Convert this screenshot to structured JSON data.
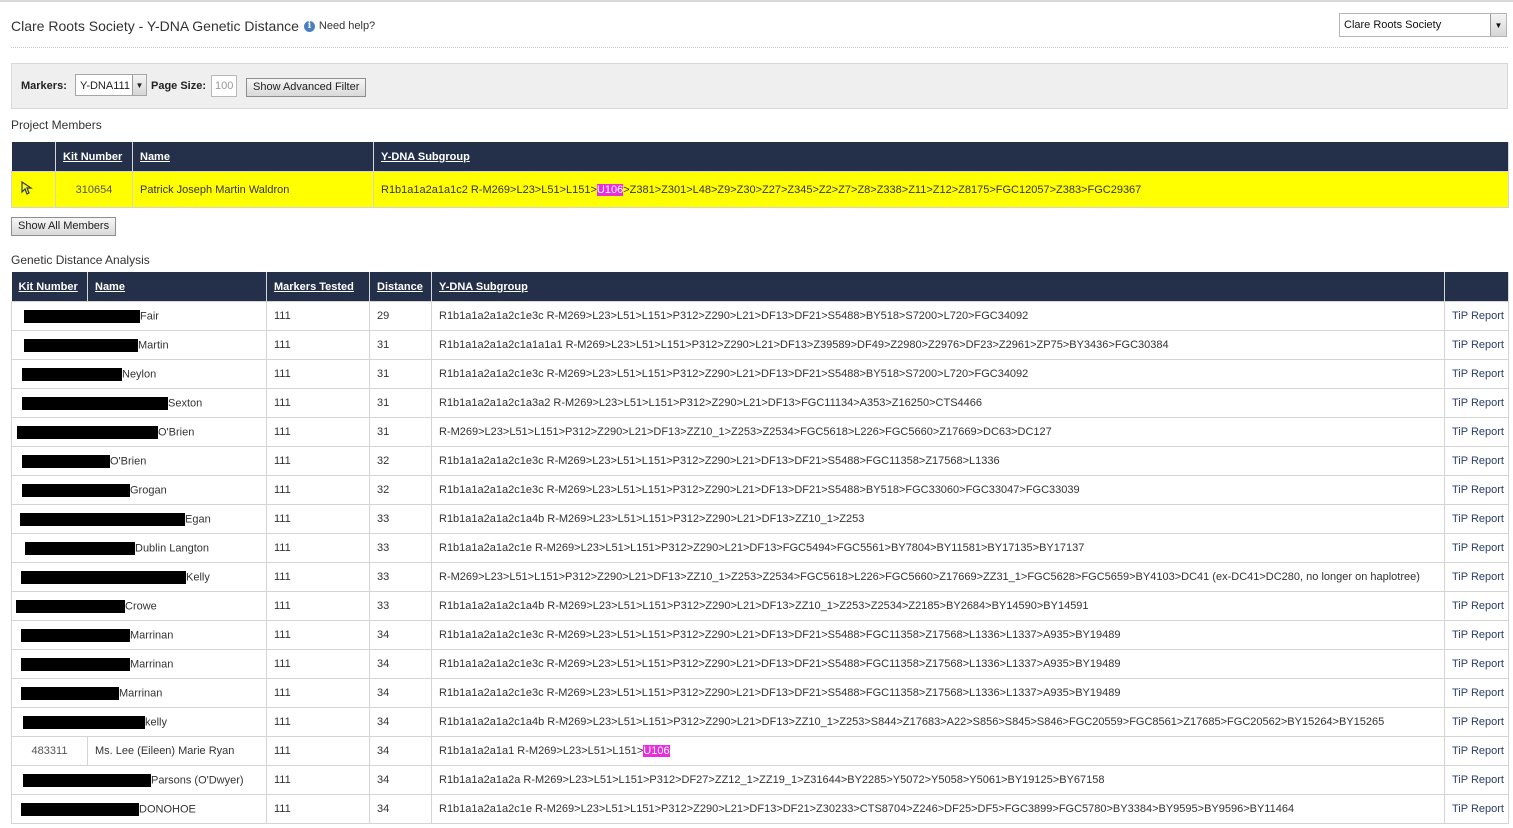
{
  "header": {
    "title": "Clare Roots Society - Y-DNA Genetic Distance",
    "help_text": "Need help?",
    "help_icon": "info-icon",
    "project_select": "Clare Roots Society"
  },
  "filter": {
    "markers_label": "Markers:",
    "markers_value": "Y-DNA111",
    "page_size_label": "Page Size:",
    "page_size_value": "100",
    "advanced_filter_button": "Show Advanced Filter"
  },
  "members": {
    "section_title": "Project Members",
    "columns": [
      "",
      "Kit Number",
      "Name",
      "Y-DNA Subgroup"
    ],
    "selected": {
      "kit": "310654",
      "name": "Patrick Joseph Martin Waldron",
      "subgroup_pre": "R1b1a1a2a1a1c2 R-M269>L23>L51>L151>",
      "subgroup_hl": "U106",
      "subgroup_post": ">Z381>Z301>L48>Z9>Z30>Z27>Z345>Z2>Z7>Z8>Z338>Z11>Z12>Z8175>FGC12057>Z383>FGC29367"
    },
    "show_all_button": "Show All Members"
  },
  "analysis": {
    "section_title": "Genetic Distance Analysis",
    "columns": [
      "Kit Number",
      "Name",
      "Markers Tested",
      "Distance",
      "Y-DNA Subgroup",
      ""
    ],
    "rows": [
      {
        "kit": "",
        "redact": 116,
        "pad": 12,
        "name": "Fair",
        "markers": "111",
        "distance": "29",
        "subgroup": "R1b1a1a2a1a2c1e3c R-M269>L23>L51>L151>P312>Z290>L21>DF13>DF21>S5488>BY518>S7200>L720>FGC34092",
        "tip": "TiP Report"
      },
      {
        "kit": "",
        "redact": 114,
        "pad": 12,
        "name": "Martin",
        "markers": "111",
        "distance": "31",
        "subgroup": "R1b1a1a2a1a2c1a1a1a1 R-M269>L23>L51>L151>P312>Z290>L21>DF13>Z39589>DF49>Z2980>Z2976>DF23>Z2961>ZP75>BY3436>FGC30384",
        "tip": "TiP Report"
      },
      {
        "kit": "",
        "redact": 100,
        "pad": 10,
        "name": "Neylon",
        "markers": "111",
        "distance": "31",
        "subgroup": "R1b1a1a2a1a2c1e3c R-M269>L23>L51>L151>P312>Z290>L21>DF13>DF21>S5488>BY518>S7200>L720>FGC34092",
        "tip": "TiP Report"
      },
      {
        "kit": "",
        "redact": 146,
        "pad": 10,
        "name": "Sexton",
        "markers": "111",
        "distance": "31",
        "subgroup": "R1b1a1a2a1a2c1a3a2 R-M269>L23>L51>L151>P312>Z290>L21>DF13>FGC11134>A353>Z16250>CTS4466",
        "tip": "TiP Report"
      },
      {
        "kit": "",
        "redact": 141,
        "pad": 5,
        "name": "O'Brien",
        "markers": "111",
        "distance": "31",
        "subgroup": "R-M269>L23>L51>L151>P312>Z290>L21>DF13>ZZ10_1>Z253>Z2534>FGC5618>L226>FGC5660>Z17669>DC63>DC127",
        "tip": "TiP Report"
      },
      {
        "kit": "",
        "redact": 88,
        "pad": 10,
        "name": "O'Brien",
        "markers": "111",
        "distance": "32",
        "subgroup": "R1b1a1a2a1a2c1e3c R-M269>L23>L51>L151>P312>Z290>L21>DF13>DF21>S5488>FGC11358>Z17568>L1336",
        "tip": "TiP Report"
      },
      {
        "kit": "",
        "redact": 108,
        "pad": 10,
        "name": "Grogan",
        "markers": "111",
        "distance": "32",
        "subgroup": "R1b1a1a2a1a2c1e3c R-M269>L23>L51>L151>P312>Z290>L21>DF13>DF21>S5488>BY518>FGC33060>FGC33047>FGC33039",
        "tip": "TiP Report"
      },
      {
        "kit": "",
        "redact": 165,
        "pad": 8,
        "name": "Egan",
        "markers": "111",
        "distance": "33",
        "subgroup": "R1b1a1a2a1a2c1a4b R-M269>L23>L51>L151>P312>Z290>L21>DF13>ZZ10_1>Z253",
        "tip": "TiP Report"
      },
      {
        "kit": "",
        "redact": 110,
        "pad": 13,
        "name": "Dublin Langton",
        "markers": "111",
        "distance": "33",
        "subgroup": "R1b1a1a2a1a2c1e R-M269>L23>L51>L151>P312>Z290>L21>DF13>FGC5494>FGC5561>BY7804>BY11581>BY17135>BY17137",
        "tip": "TiP Report"
      },
      {
        "kit": "",
        "redact": 165,
        "pad": 9,
        "name": "Kelly",
        "markers": "111",
        "distance": "33",
        "subgroup": "R-M269>L23>L51>L151>P312>Z290>L21>DF13>ZZ10_1>Z253>Z2534>FGC5618>L226>FGC5660>Z17669>ZZ31_1>FGC5628>FGC5659>BY4103>DC41 (ex-DC41>DC280, no longer on haplotree)",
        "tip": "TiP Report"
      },
      {
        "kit": "",
        "redact": 109,
        "pad": 4,
        "name": "Crowe",
        "markers": "111",
        "distance": "33",
        "subgroup": "R1b1a1a2a1a2c1a4b R-M269>L23>L51>L151>P312>Z290>L21>DF13>ZZ10_1>Z253>Z2534>Z2185>BY2684>BY14590>BY14591",
        "tip": "TiP Report"
      },
      {
        "kit": "",
        "redact": 109,
        "pad": 9,
        "name": "Marrinan",
        "markers": "111",
        "distance": "34",
        "subgroup": "R1b1a1a2a1a2c1e3c R-M269>L23>L51>L151>P312>Z290>L21>DF13>DF21>S5488>FGC11358>Z17568>L1336>L1337>A935>BY19489",
        "tip": "TiP Report"
      },
      {
        "kit": "",
        "redact": 109,
        "pad": 9,
        "name": "Marrinan",
        "markers": "111",
        "distance": "34",
        "subgroup": "R1b1a1a2a1a2c1e3c R-M269>L23>L51>L151>P312>Z290>L21>DF13>DF21>S5488>FGC11358>Z17568>L1336>L1337>A935>BY19489",
        "tip": "TiP Report"
      },
      {
        "kit": "",
        "redact": 98,
        "pad": 9,
        "name": "Marrinan",
        "markers": "111",
        "distance": "34",
        "subgroup": "R1b1a1a2a1a2c1e3c R-M269>L23>L51>L151>P312>Z290>L21>DF13>DF21>S5488>FGC11358>Z17568>L1336>L1337>A935>BY19489",
        "tip": "TiP Report"
      },
      {
        "kit": "",
        "redact": 122,
        "pad": 11,
        "name": "kelly",
        "markers": "111",
        "distance": "34",
        "subgroup": "R1b1a1a2a1a2c1a4b R-M269>L23>L51>L151>P312>Z290>L21>DF13>ZZ10_1>Z253>S844>Z17683>A22>S856>S845>S846>FGC20559>FGC8561>Z17685>FGC20562>BY15264>BY15265",
        "tip": "TiP Report"
      },
      {
        "kit": "483311",
        "redact": 0,
        "pad": 0,
        "name": "Ms. Lee (Eileen) Marie Ryan",
        "markers": "111",
        "distance": "34",
        "subgroup_pre": "R1b1a1a2a1a1 R-M269>L23>L51>L151>",
        "subgroup_hl": "U106",
        "tip": "TiP Report"
      },
      {
        "kit": "",
        "redact": 128,
        "pad": 11,
        "name": "Parsons (O'Dwyer)",
        "markers": "111",
        "distance": "34",
        "subgroup": "R1b1a1a2a1a2a R-M269>L23>L51>L151>P312>DF27>ZZ12_1>ZZ19_1>Z31644>BY2285>Y5072>Y5058>Y5061>BY19125>BY67158",
        "tip": "TiP Report"
      },
      {
        "kit": "",
        "redact": 118,
        "pad": 9,
        "name": "DONOHOE",
        "markers": "111",
        "distance": "34",
        "subgroup": "R1b1a1a2a1a2c1e R-M269>L23>L51>L151>P312>Z290>L21>DF13>DF21>Z30233>CTS8704>Z246>DF25>DF5>FGC3899>FGC5780>BY3384>BY9595>BY9596>BY11464",
        "tip": "TiP Report"
      }
    ]
  },
  "colors": {
    "header_bg": "#243049",
    "selected_row": "#ffff00",
    "highlight": "#e82ee0"
  }
}
